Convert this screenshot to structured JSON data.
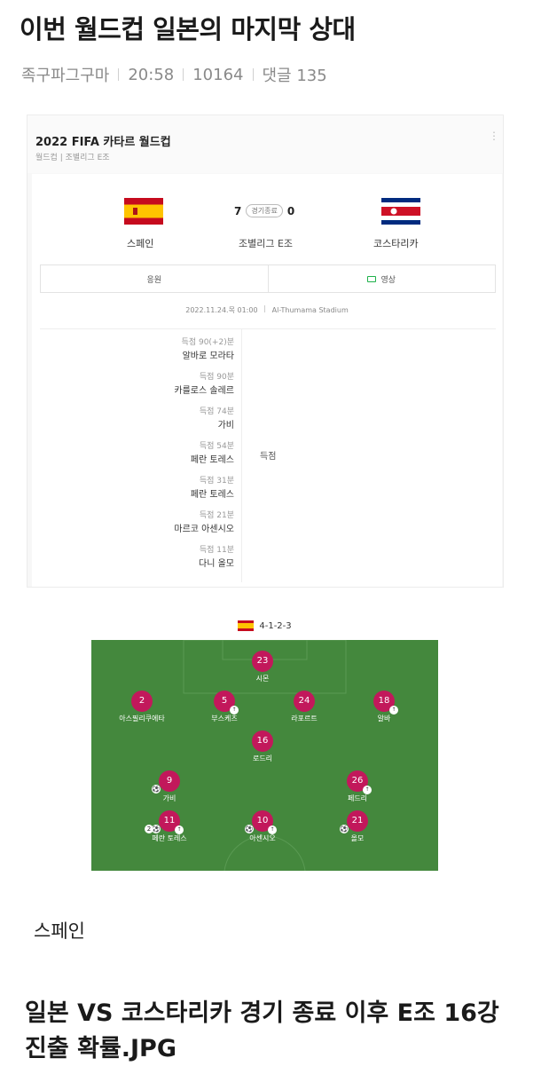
{
  "post": {
    "title": "이번 월드컵 일본의 마지막 상대",
    "author": "족구파그구마",
    "time": "20:58",
    "views": "10164",
    "comments": "댓글 135"
  },
  "card": {
    "title": "2022 FIFA 카타르 월드컵",
    "subtitle": "월드컵 | 조별리그 E조",
    "home_team": "스페인",
    "away_team": "코스타리카",
    "home_score": "7",
    "away_score": "0",
    "status": "경기종료",
    "group": "조별리그 E조",
    "cheer_label": "응원",
    "video_label": "영상",
    "datetime": "2022.11.24.목 01:00",
    "stadium": "Al-Thumama Stadium",
    "goals_label": "득점",
    "goals": [
      {
        "time": "득점 90(+2)분",
        "player": "알바로 모라타"
      },
      {
        "time": "득점 90분",
        "player": "카를로스 솔레르"
      },
      {
        "time": "득점 74분",
        "player": "가비"
      },
      {
        "time": "득점 54분",
        "player": "페란 토레스"
      },
      {
        "time": "득점 31분",
        "player": "페란 토레스"
      },
      {
        "time": "득점 21분",
        "player": "마르코 아센시오"
      },
      {
        "time": "득점 11분",
        "player": "다니 올모"
      }
    ]
  },
  "lineup": {
    "formation": "4-1-2-3",
    "players": [
      {
        "num": "23",
        "name": "시몬",
        "sub": false,
        "goals": 0
      },
      {
        "num": "2",
        "name": "아스필리쿠에타",
        "sub": false,
        "goals": 0
      },
      {
        "num": "5",
        "name": "부스케츠",
        "sub": true,
        "goals": 0
      },
      {
        "num": "24",
        "name": "라포르트",
        "sub": false,
        "goals": 0
      },
      {
        "num": "18",
        "name": "알바",
        "sub": true,
        "goals": 0
      },
      {
        "num": "16",
        "name": "로드리",
        "sub": false,
        "goals": 0
      },
      {
        "num": "9",
        "name": "가비",
        "sub": false,
        "goals": 1
      },
      {
        "num": "26",
        "name": "페드리",
        "sub": true,
        "goals": 0
      },
      {
        "num": "11",
        "name": "페란 토레스",
        "sub": true,
        "goals": 2
      },
      {
        "num": "10",
        "name": "아센시오",
        "sub": true,
        "goals": 1
      },
      {
        "num": "21",
        "name": "올모",
        "sub": false,
        "goals": 1
      }
    ]
  },
  "caption": "스페인",
  "headline": "일본 VS 코스타리카 경기 종료 이후 E조 16강 진출 확률.JPG",
  "colors": {
    "pitch": "#44883d",
    "player_dot": "#c2185b",
    "video_green": "#1fb14b"
  }
}
